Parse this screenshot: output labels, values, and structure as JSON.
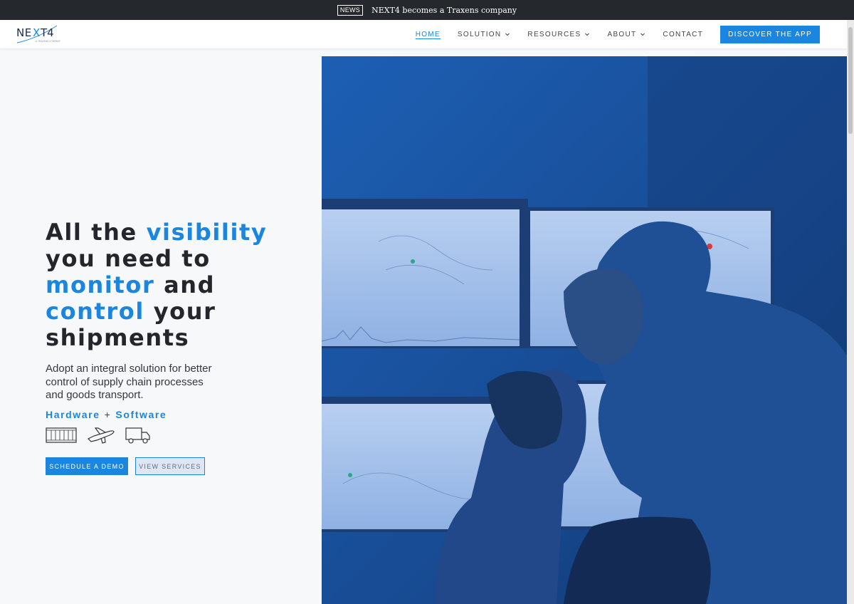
{
  "news": {
    "badge": "NEWS",
    "text": "NEXT4 becomes a Traxens company"
  },
  "logo": {
    "wordmark": "NEXT4",
    "tagline": "A TRAXENS COMPANY"
  },
  "nav": {
    "items": [
      {
        "label": "HOME",
        "active": true,
        "dropdown": false
      },
      {
        "label": "SOLUTION",
        "active": false,
        "dropdown": true
      },
      {
        "label": "RESOURCES",
        "active": false,
        "dropdown": true
      },
      {
        "label": "ABOUT",
        "active": false,
        "dropdown": true
      },
      {
        "label": "CONTACT",
        "active": false,
        "dropdown": false
      }
    ],
    "cta": "DISCOVER THE APP"
  },
  "hero": {
    "title": {
      "w1": "All the",
      "w2": "visibility",
      "w3": "you need to",
      "w4": "monitor",
      "w5": "and",
      "w6": "control",
      "w7": "your",
      "w8": "shipments"
    },
    "subtitle": "Adopt an integral solution for better control of supply chain processes and goods transport.",
    "hardware": "Hardware",
    "plus": "+",
    "software": "Software",
    "icons": [
      "container-icon",
      "airplane-icon",
      "truck-icon"
    ],
    "btn_demo": "SCHEDULE A DEMO",
    "btn_services": "VIEW SERVICES"
  },
  "colors": {
    "accent": "#1a86e0",
    "dark_text": "#23262a",
    "newsbar": "#25292d",
    "hero_overlay": "#1a4a8c"
  }
}
